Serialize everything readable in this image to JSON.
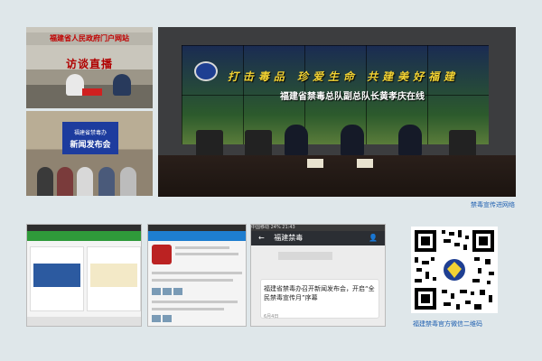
{
  "photo_interview": {
    "banner": "福建省人民政府门户网站",
    "title": "访谈直播"
  },
  "photo_press": {
    "screen_line1": "福建省禁毒办",
    "screen_line2": "新闻发布会"
  },
  "photo_conference": {
    "slogan": "打击毒品 珍爱生命 共建美好福建",
    "subtitle": "福建省禁毒总队副总队长黄孝庆在线"
  },
  "credit": "禁毒宣传进网络",
  "phone3": {
    "status": "中国移动 24% 21:43",
    "title": "福建禁毒",
    "message": "福建省禁毒办召开新闻发布会，开启“全民禁毒宣传月”序幕",
    "date": "6月4日"
  },
  "qr_caption": "福建禁毒官方微信二维码",
  "colors": {
    "accent": "#1e5fb0",
    "background": "#dfe7ea"
  }
}
